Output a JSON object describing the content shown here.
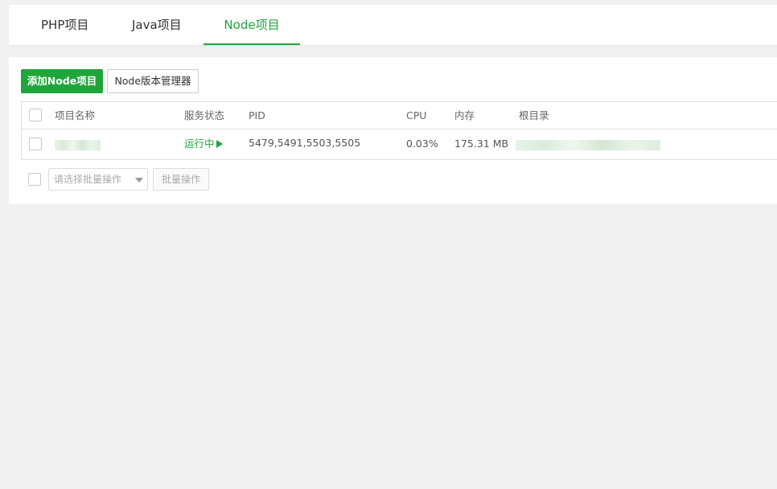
{
  "tabs": {
    "php": "PHP项目",
    "java": "Java项目",
    "node": "Node项目",
    "active": "node"
  },
  "toolbar": {
    "add_node_label": "添加Node项目",
    "version_manager_label": "Node版本管理器"
  },
  "table": {
    "headers": {
      "name": "项目名称",
      "status": "服务状态",
      "pid": "PID",
      "cpu": "CPU",
      "memory": "内存",
      "root": "根目录"
    },
    "rows": [
      {
        "status": "运行中",
        "pid": "5479,5491,5503,5505",
        "cpu": "0.03%",
        "memory": "175.31 MB"
      }
    ]
  },
  "batch": {
    "select_placeholder": "请选择批量操作",
    "action_label": "批量操作"
  },
  "colors": {
    "accent": "#20a53a",
    "background": "#f1f1f1"
  },
  "icons": {
    "status": "play-icon",
    "dropdown": "chevron-down-icon"
  }
}
